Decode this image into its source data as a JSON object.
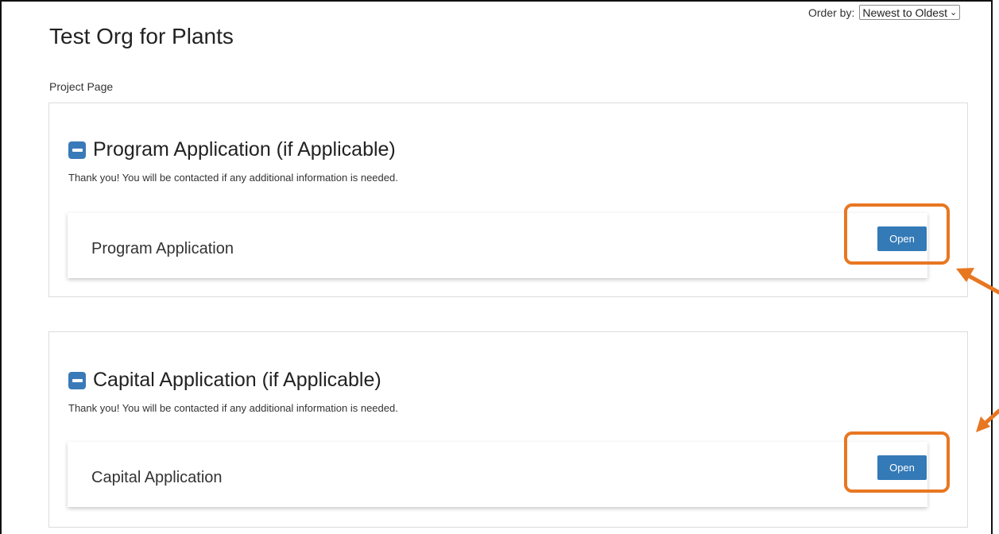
{
  "order_by": {
    "label": "Order by:",
    "selected": "Newest to Oldest"
  },
  "page": {
    "title": "Test Org for Plants",
    "subtitle": "Project Page"
  },
  "sections": [
    {
      "title": "Program Application (if Applicable)",
      "note": "Thank you! You will be contacted if any additional information is needed.",
      "card_title": "Program Application",
      "button_label": "Open"
    },
    {
      "title": "Capital Application (if Applicable)",
      "note": "Thank you! You will be contacted if any additional information is needed.",
      "card_title": "Capital Application",
      "button_label": "Open"
    }
  ],
  "annotation": {
    "highlight_color": "#e87722",
    "button_color": "#337ab7",
    "collapse_icon_color": "#3a7ab8"
  }
}
